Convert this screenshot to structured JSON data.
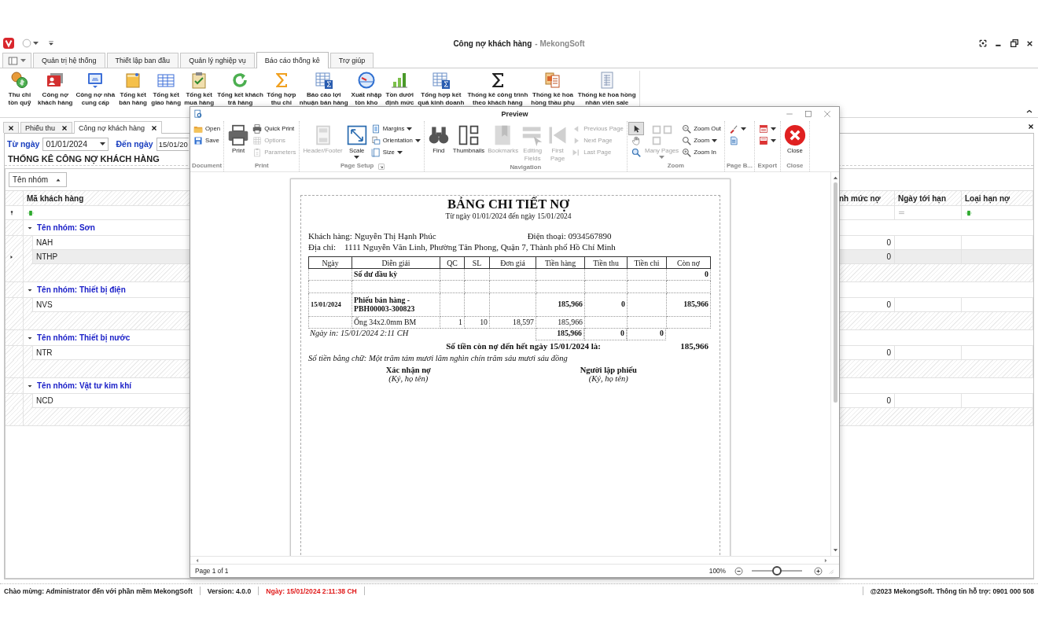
{
  "window": {
    "title": "Công nợ khách hàng",
    "app_name": "- MekongSoft"
  },
  "menu_tabs": [
    {
      "label": "Quản trị hệ thống",
      "selected": false
    },
    {
      "label": "Thiết lập ban đầu",
      "selected": false
    },
    {
      "label": "Quản lý nghiệp vụ",
      "selected": false
    },
    {
      "label": "Báo cáo thống kê",
      "selected": true
    },
    {
      "label": "Trợ giúp",
      "selected": false
    }
  ],
  "ribbon": [
    {
      "label": "Thu chi\ntồn quỹ"
    },
    {
      "label": "Công nợ\nkhách hàng"
    },
    {
      "label": "Công nợ nhà\ncung cấp"
    },
    {
      "label": "Tổng kết\nbán hàng"
    },
    {
      "label": "Tổng kết\ngiao hàng"
    },
    {
      "label": "Tổng kết\nmua hàng"
    },
    {
      "label": "Tổng kết khách\ntrả hàng"
    },
    {
      "label": "Tổng hợp\nthu chi"
    },
    {
      "label": "Báo cáo lợi\nnhuận bán hàng"
    },
    {
      "label": "Xuất nhập\ntồn kho"
    },
    {
      "label": "Tồn dưới\nđịnh mức"
    },
    {
      "label": "Tổng hợp kết\nquả kinh doanh"
    },
    {
      "label": "Thống kê công trình\ntheo khách hàng"
    },
    {
      "label": "Thống kê hoa\nhồng thầu phụ"
    },
    {
      "label": "Thống kê hoa hồng\nnhân viên sale"
    }
  ],
  "doc_tabs": [
    {
      "selected": false
    },
    {
      "label": "Phiếu thu",
      "selected": false
    },
    {
      "label": "Công nợ khách hàng",
      "selected": true
    }
  ],
  "filter": {
    "from_label": "Từ ngày",
    "from_value": "01/01/2024",
    "to_label": "Đến ngày",
    "to_value": "15/01/20"
  },
  "report_heading": "THỐNG KÊ CÔNG NỢ KHÁCH HÀNG",
  "group_panel": {
    "label": "Tên nhóm"
  },
  "grid": {
    "columns": [
      "Mã khách hàng",
      "nh mức nợ",
      "Ngày tới hạn",
      "Loại hạn nợ"
    ],
    "groups": [
      {
        "label": "Tên nhóm: Sơn",
        "expanded": true,
        "rows": [
          {
            "code": "NAH",
            "debt_limit": "0",
            "selected": false
          },
          {
            "code": "NTHP",
            "debt_limit": "0",
            "selected": true
          }
        ]
      },
      {
        "label": "Tên nhóm: Thiết bị điện",
        "expanded": true,
        "rows": [
          {
            "code": "NVS",
            "debt_limit": "0",
            "selected": false
          }
        ]
      },
      {
        "label": "Tên nhóm: Thiết bị nước",
        "expanded": true,
        "rows": [
          {
            "code": "NTR",
            "debt_limit": "0",
            "selected": false
          }
        ]
      },
      {
        "label": "Tên nhóm: Vật tư kim khí",
        "expanded": true,
        "rows": [
          {
            "code": "NCD",
            "debt_limit": "0",
            "selected": false
          }
        ]
      }
    ]
  },
  "preview": {
    "title": "Preview",
    "ribbon_groups": [
      {
        "label": "Document",
        "items": [
          {
            "kind": "small",
            "label": "Open",
            "disabled": false
          },
          {
            "kind": "small",
            "label": "Save",
            "disabled": false
          }
        ]
      },
      {
        "label": "Print",
        "items": [
          {
            "kind": "large",
            "label": "Print",
            "disabled": false
          },
          {
            "kind": "small",
            "label": "Quick Print",
            "disabled": false
          },
          {
            "kind": "small",
            "label": "Options",
            "disabled": true
          },
          {
            "kind": "small",
            "label": "Parameters",
            "disabled": true
          }
        ]
      },
      {
        "label": "Page Setup",
        "dialog_launcher": true,
        "items": [
          {
            "kind": "large",
            "label": "Header/Footer",
            "disabled": true
          },
          {
            "kind": "large",
            "label": "Scale",
            "disabled": false,
            "dropdown": true
          },
          {
            "kind": "small",
            "label": "Margins",
            "disabled": false,
            "dropdown": true
          },
          {
            "kind": "small",
            "label": "Orientation",
            "disabled": false,
            "dropdown": true
          },
          {
            "kind": "small",
            "label": "Size",
            "disabled": false,
            "dropdown": true
          }
        ]
      },
      {
        "label": "Navigation",
        "items": [
          {
            "kind": "large",
            "label": "Find",
            "disabled": false
          },
          {
            "kind": "large",
            "label": "Thumbnails",
            "disabled": false
          },
          {
            "kind": "large",
            "label": "Bookmarks",
            "disabled": true
          },
          {
            "kind": "large",
            "label": "Editing\nFields",
            "disabled": true
          },
          {
            "kind": "large",
            "label": "First\nPage",
            "disabled": true
          },
          {
            "kind": "small",
            "label": "Previous Page",
            "disabled": true
          },
          {
            "kind": "small",
            "label": "Next Page",
            "disabled": true
          },
          {
            "kind": "small",
            "label": "Last Page",
            "disabled": true
          }
        ]
      },
      {
        "label": "Zoom",
        "items": [
          {
            "kind": "tool",
            "selected": true,
            "disabled": false
          },
          {
            "kind": "tool",
            "selected": false,
            "disabled": false
          },
          {
            "kind": "tool",
            "selected": false,
            "disabled": false
          },
          {
            "kind": "large",
            "label": "Many Pages",
            "disabled": true,
            "dropdown": true
          },
          {
            "kind": "small",
            "label": "Zoom Out",
            "disabled": false
          },
          {
            "kind": "small",
            "label": "Zoom",
            "disabled": false,
            "dropdown": true
          },
          {
            "kind": "small",
            "label": "Zoom In",
            "disabled": false
          }
        ]
      },
      {
        "label": "Page B...",
        "items": [
          {
            "kind": "tool",
            "selected": false,
            "disabled": false,
            "dropdown": true
          },
          {
            "kind": "tool",
            "selected": false,
            "disabled": false
          }
        ]
      },
      {
        "label": "Export",
        "items": [
          {
            "kind": "tool",
            "selected": false,
            "disabled": false,
            "dropdown": true
          },
          {
            "kind": "tool",
            "selected": false,
            "disabled": false,
            "dropdown": true
          }
        ]
      },
      {
        "label": "Close",
        "items": [
          {
            "kind": "large",
            "label": "Close",
            "disabled": false
          }
        ]
      }
    ],
    "report": {
      "title": "BẢNG CHI TIẾT NỢ",
      "period": "Từ ngày 01/01/2024 đến ngày 15/01/2024",
      "customer_label": "Khách hàng:",
      "customer": "Nguyễn Thị Hạnh Phúc",
      "phone_label": "Điện thoại:",
      "phone": "0934567890",
      "address_label": "Địa chỉ:",
      "address": "1111 Nguyễn Văn Linh, Phường Tân Phong, Quận 7, Thành phố Hồ Chí Minh",
      "columns": [
        "Ngày",
        "Diễn giải",
        "QC",
        "SL",
        "Đơn giá",
        "Tiền hàng",
        "Tiền thu",
        "Tiền chi",
        "Còn nợ"
      ],
      "rows": [
        {
          "kind": "opening",
          "cells": [
            null,
            "Số dư đầu kỳ",
            null,
            null,
            null,
            null,
            null,
            null,
            "0"
          ]
        },
        {
          "kind": "blank"
        },
        {
          "kind": "document",
          "cells": [
            "15/01/2024",
            "Phiếu bán hàng - PBH00003-300823",
            null,
            null,
            null,
            "185,966",
            "0",
            null,
            "185,966"
          ]
        },
        {
          "kind": "item",
          "cells": [
            null,
            "Ống 34x2.0mm BM",
            "1",
            "10",
            "18,597",
            "185,966",
            null,
            null,
            null
          ]
        }
      ],
      "printed_at": "Ngày in: 15/01/2024 2:11 CH",
      "totals": [
        "185,966",
        "0",
        "0"
      ],
      "balance_label": "Số tiền còn nợ đến hết ngày 15/01/2024 là:",
      "balance": "185,966",
      "in_words": "Số tiền bằng chữ: Một trăm tám mươi lăm nghìn chín trăm sáu mươi sáu đồng",
      "signatures": [
        {
          "title": "Xác nhận nợ",
          "note": "(Ký, họ tên)"
        },
        {
          "title": "Người lập phiếu",
          "note": "(Ký, họ tên)"
        }
      ]
    },
    "page_status": "Page 1 of 1",
    "zoom": {
      "reading": "100%",
      "level": 0.5
    }
  },
  "status_bar": {
    "welcome": "Chào mừng: Administrator đến với phần mềm MekongSoft",
    "version": "Version: 4.0.0",
    "date": "Ngày: 15/01/2024 2:11:38 CH",
    "support": "@2023 MekongSoft. Thông tin hỗ trợ: 0901 000 508"
  }
}
